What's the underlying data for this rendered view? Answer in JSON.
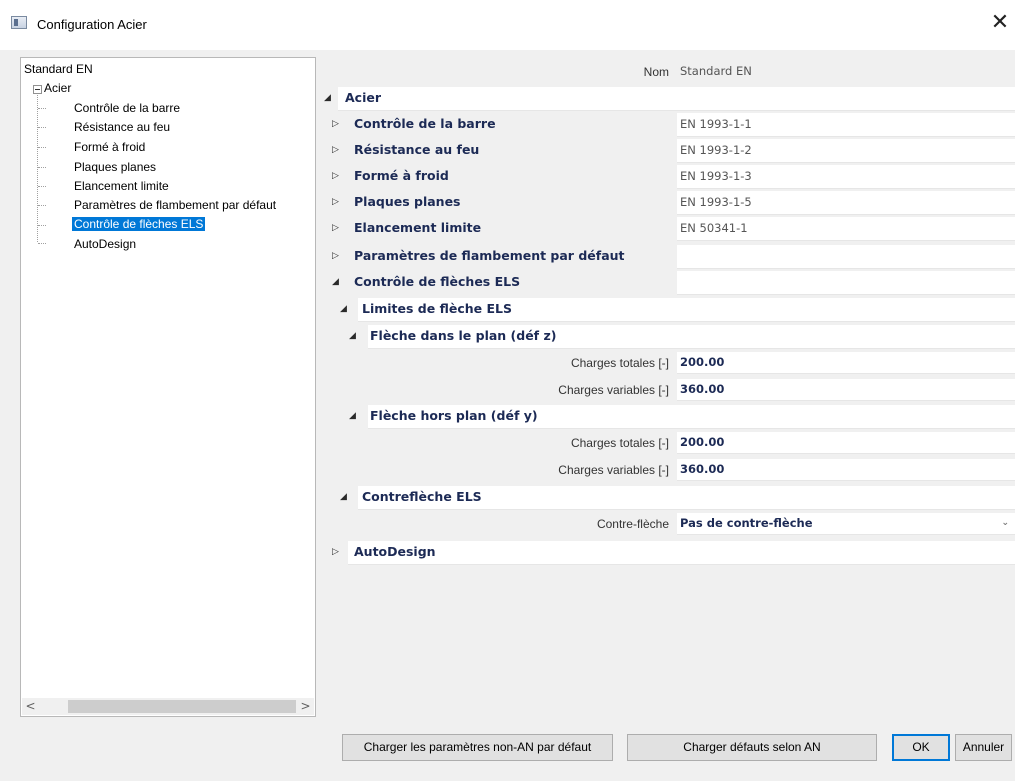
{
  "window": {
    "title": "Configuration Acier",
    "close_glyph": "✕",
    "icon": "app-window-icon"
  },
  "tree": {
    "root": "Standard EN",
    "parent": "Acier",
    "children": [
      "Contrôle de la barre",
      "Résistance au feu",
      "Formé à froid",
      "Plaques planes",
      "Elancement limite",
      "Paramètres de flambement par défaut",
      "Contrôle de flèches ELS",
      "AutoDesign"
    ],
    "selected_index": 6,
    "scroll_left": "<",
    "scroll_right": ">"
  },
  "props": {
    "nom_label": "Nom",
    "nom_value": "Standard EN",
    "acier": "Acier",
    "controle_barre": {
      "label": "Contrôle de la barre",
      "value": "EN 1993-1-1"
    },
    "resistance_feu": {
      "label": "Résistance au feu",
      "value": "EN 1993-1-2"
    },
    "forme_froid": {
      "label": "Formé à froid",
      "value": "EN 1993-1-3"
    },
    "plaques_planes": {
      "label": "Plaques planes",
      "value": "EN 1993-1-5"
    },
    "elancement": {
      "label": "Elancement limite",
      "value": "EN 50341-1"
    },
    "flambement": {
      "label": "Paramètres de flambement par défaut"
    },
    "fleches_els": {
      "label": "Contrôle de flèches ELS"
    },
    "limites": {
      "label": "Limites de flèche ELS"
    },
    "plan_z": {
      "label": "Flèche dans le plan (déf z)",
      "totales_label": "Charges totales [-]",
      "totales_value": "200.00",
      "variables_label": "Charges variables [-]",
      "variables_value": "360.00"
    },
    "hors_plan_y": {
      "label": "Flèche hors plan (déf y)",
      "totales_label": "Charges totales [-]",
      "totales_value": "200.00",
      "variables_label": "Charges variables [-]",
      "variables_value": "360.00"
    },
    "contrefleche": {
      "label": "Contreflèche ELS",
      "field_label": "Contre-flèche",
      "field_value": "Pas de contre-flèche"
    },
    "autodesign": {
      "label": "AutoDesign"
    },
    "expanded_glyph": "◢",
    "collapsed_glyph": "▷",
    "dropdown_glyph": "⌄"
  },
  "buttons": {
    "load_non_an": "Charger les paramètres non-AN par défaut",
    "load_an": "Charger défauts selon AN",
    "ok": "OK",
    "cancel": "Annuler"
  }
}
